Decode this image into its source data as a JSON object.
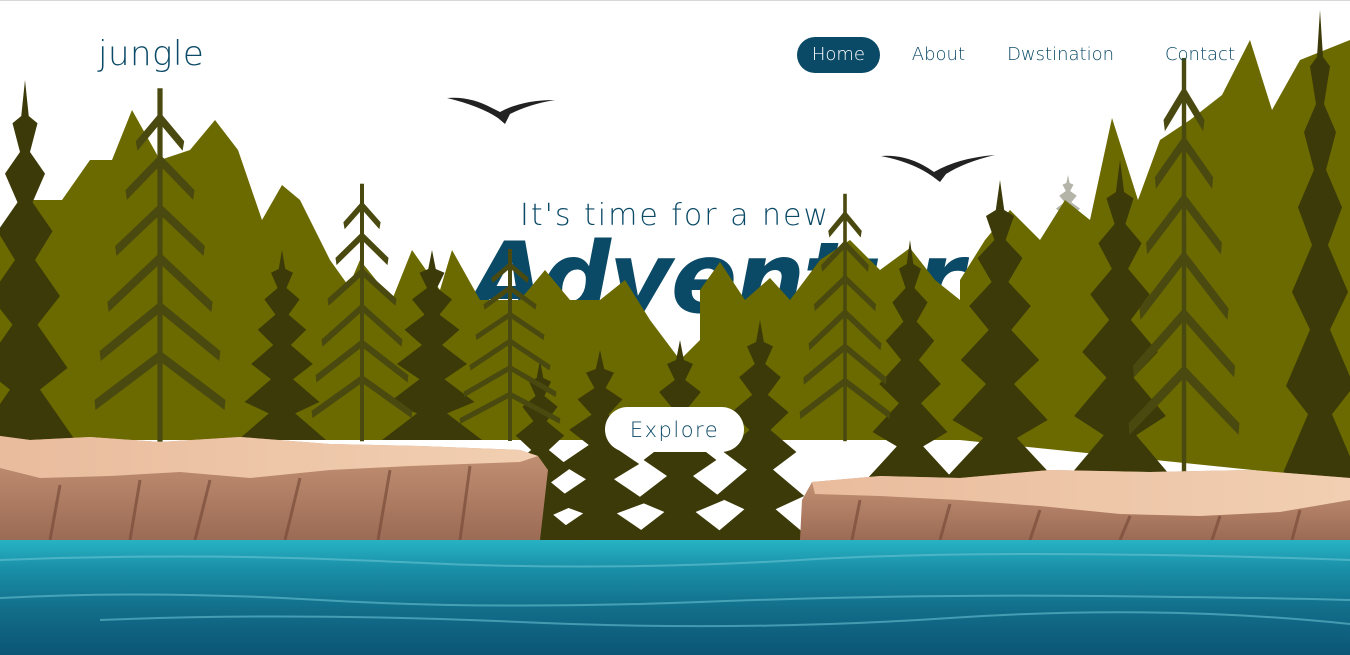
{
  "brand": {
    "logo_text": "jungle"
  },
  "nav": {
    "items": [
      {
        "label": "Home",
        "active": true
      },
      {
        "label": "About",
        "active": false
      },
      {
        "label": "Dwstination",
        "active": false
      },
      {
        "label": "Contact",
        "active": false
      }
    ]
  },
  "hero": {
    "tagline": "It's time for a new",
    "headline": "Adventure",
    "cta_label": "Explore"
  },
  "colors": {
    "primary": "#0b4a66",
    "forest_olive": "#6b6a00",
    "forest_dark": "#3a3a0a",
    "cliff": "#b98a6e",
    "water": "#1a7f96"
  },
  "decor": {
    "birds": [
      "bird-icon",
      "bird-icon"
    ]
  }
}
